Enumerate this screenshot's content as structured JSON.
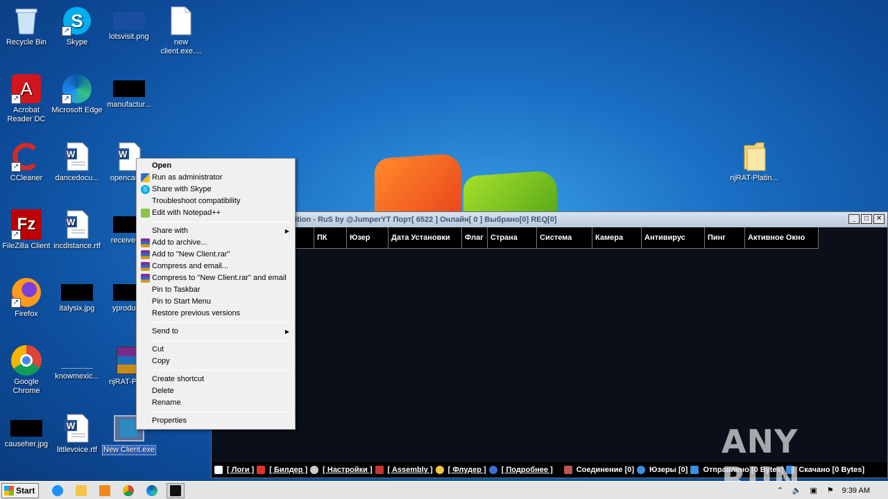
{
  "desktop_icons": [
    {
      "label": "Recycle Bin",
      "icon": "recycle-bin-icon"
    },
    {
      "label": "Skype",
      "icon": "skype-icon"
    },
    {
      "label": "lotsvisit.png",
      "icon": "image-file-icon"
    },
    {
      "label": "new client.exe....",
      "icon": "blank-file-icon"
    },
    {
      "label": "Acrobat Reader DC",
      "icon": "acrobat-icon"
    },
    {
      "label": "Microsoft Edge",
      "icon": "edge-icon"
    },
    {
      "label": "manufactur...",
      "icon": "image-file-icon"
    },
    {
      "label": "CCleaner",
      "icon": "ccleaner-icon"
    },
    {
      "label": "dancedocu...",
      "icon": "word-doc-icon"
    },
    {
      "label": "opencam...",
      "icon": "word-doc-icon"
    },
    {
      "label": "FileZilla Client",
      "icon": "filezilla-icon"
    },
    {
      "label": "incdistance.rtf",
      "icon": "word-doc-icon"
    },
    {
      "label": "receivesi...",
      "icon": "image-file-icon"
    },
    {
      "label": "Firefox",
      "icon": "firefox-icon"
    },
    {
      "label": "italysix.jpg",
      "icon": "image-file-icon"
    },
    {
      "label": "yproduc...",
      "icon": "image-file-icon"
    },
    {
      "label": "Google Chrome",
      "icon": "chrome-icon"
    },
    {
      "label": "knowmexic...",
      "icon": "image-file-icon"
    },
    {
      "label": "njRAT-Pla...",
      "icon": "winrar-icon"
    },
    {
      "label": "causeher.jpg",
      "icon": "image-file-icon"
    },
    {
      "label": "littlevoice.rtf",
      "icon": "word-doc-icon"
    },
    {
      "label": "New Client.exe",
      "icon": "exe-icon"
    },
    {
      "label": "njRAT-Platin...",
      "icon": "folder-icon"
    }
  ],
  "context_menu": {
    "items": [
      {
        "label": "Open",
        "bold": true
      },
      {
        "label": "Run as administrator",
        "icon": "shield-icon"
      },
      {
        "label": "Share with Skype",
        "icon": "skype-icon"
      },
      {
        "label": "Troubleshoot compatibility"
      },
      {
        "label": "Edit with Notepad++",
        "icon": "notepadpp-icon"
      },
      {
        "label": "Share with",
        "submenu": true
      },
      {
        "label": "Add to archive...",
        "icon": "winrar-icon"
      },
      {
        "label": "Add to \"New Client.rar\"",
        "icon": "winrar-icon"
      },
      {
        "label": "Compress and email...",
        "icon": "winrar-icon"
      },
      {
        "label": "Compress to \"New Client.rar\" and email",
        "icon": "winrar-icon"
      },
      {
        "label": "Pin to Taskbar"
      },
      {
        "label": "Pin to Start Menu"
      },
      {
        "label": "Restore previous versions"
      },
      {
        "label": "Send to",
        "submenu": true
      },
      {
        "label": "Cut"
      },
      {
        "label": "Copy"
      },
      {
        "label": "Create shortcut"
      },
      {
        "label": "Delete"
      },
      {
        "label": "Rename"
      },
      {
        "label": "Properties"
      }
    ]
  },
  "njrat": {
    "title": "ition - RuS by @JumperYT    Порт[ 6522 ]    Онлайн[ 0 ]    Выбрано[0] REQ[0]",
    "columns": [
      "",
      "ПК",
      "Юзер",
      "Дата Установки",
      "Флаг",
      "Страна",
      "Система",
      "Камера",
      "Антивирус",
      "Пинг",
      "Активное Окно"
    ],
    "status_links": [
      "[ Логи ]",
      "[ Билдер ]",
      "[ Настройки ]",
      "[ Assembly ]",
      "[ Флудер ]",
      "[ Подробнее ]"
    ],
    "status_stats": [
      "Соединение [0]",
      "Юзеры [0]",
      "Отправлено [0 Bytes]",
      "Скачано [0 Bytes]"
    ]
  },
  "watermark": "ANY RUN",
  "taskbar": {
    "start_label": "Start",
    "apps": [
      "ie-icon",
      "explorer-icon",
      "media-player-icon",
      "chrome-icon",
      "edge-icon",
      "njrat-icon"
    ],
    "clock": "9:39 AM"
  }
}
